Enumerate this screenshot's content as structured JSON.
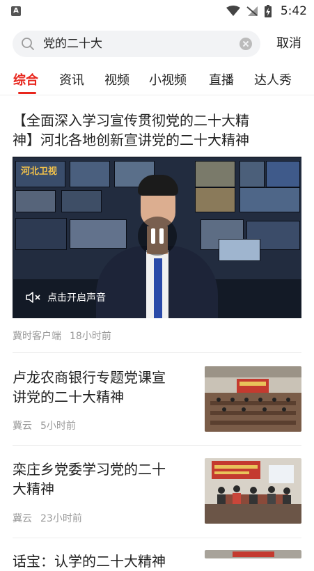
{
  "statusbar": {
    "time": "5:42",
    "app_badge": "A"
  },
  "search": {
    "query": "党的二十大",
    "cancel_label": "取消"
  },
  "tabs": [
    {
      "label": "综合",
      "active": true
    },
    {
      "label": "资讯"
    },
    {
      "label": "视频"
    },
    {
      "label": "小视频"
    },
    {
      "label": "直播"
    },
    {
      "label": "达人秀"
    }
  ],
  "feed": [
    {
      "title_line1": "【全面深入学习宣传贯彻党的二十大精",
      "title_line2": "神】河北各地创新宣讲党的二十大精神",
      "source": "冀时客户端",
      "time": "18小时前",
      "video": {
        "mute_label": "点击开启声音",
        "logo": "河北卫视"
      }
    },
    {
      "title_line1": "卢龙农商银行专题党课宣",
      "title_line2": "讲党的二十大精神",
      "source": "冀云",
      "time": "5小时前"
    },
    {
      "title_line1": "栾庄乡党委学习党的二十",
      "title_line2": "大精神",
      "source": "冀云",
      "time": "23小时前"
    },
    {
      "title_line1": "话宝：认学的二十大精神"
    }
  ],
  "colors": {
    "accent": "#e8261d",
    "meta": "#999999",
    "search_bg": "#f2f3f5"
  }
}
